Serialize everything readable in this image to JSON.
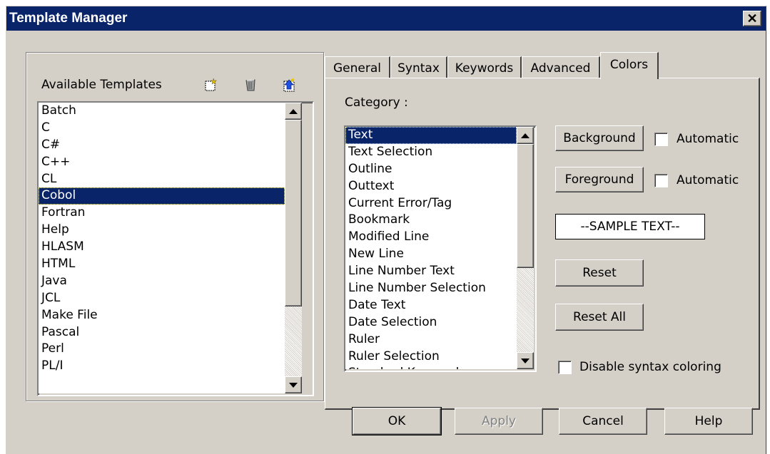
{
  "window": {
    "title": "Template Manager",
    "close_glyph": "✕"
  },
  "templates": {
    "header": "Available Templates",
    "toolbar_icons": [
      "new-template-icon",
      "delete-template-icon",
      "import-template-icon"
    ],
    "items": [
      "Batch",
      "C",
      "C#",
      "C++",
      "CL",
      "Cobol",
      "Fortran",
      "Help",
      "HLASM",
      "HTML",
      "Java",
      "JCL",
      "Make File",
      "Pascal",
      "Perl",
      "PL/I"
    ],
    "selected": "Cobol"
  },
  "tabs": [
    {
      "label": "General"
    },
    {
      "label": "Syntax"
    },
    {
      "label": "Keywords"
    },
    {
      "label": "Advanced"
    },
    {
      "label": "Colors",
      "active": true
    }
  ],
  "colors": {
    "category_label": "Category :",
    "categories": [
      "Text",
      "Text Selection",
      "Outline",
      "Outtext",
      "Current Error/Tag",
      "Bookmark",
      "Modified Line",
      "New Line",
      "Line Number Text",
      "Line Number Selection",
      "Date Text",
      "Date Selection",
      "Ruler",
      "Ruler Selection",
      "Standard Keywords"
    ],
    "selected_category": "Text",
    "background_button": "Background",
    "foreground_button": "Foreground",
    "automatic_label_1": "Automatic",
    "automatic_label_2": "Automatic",
    "automatic_bg_checked": false,
    "automatic_fg_checked": false,
    "sample_text": "--SAMPLE TEXT--",
    "reset_button": "Reset",
    "reset_all_button": "Reset All",
    "disable_syntax_label": "Disable syntax coloring",
    "disable_syntax_checked": false
  },
  "footer": {
    "ok": "OK",
    "apply": "Apply",
    "cancel": "Cancel",
    "help": "Help"
  },
  "theme": {
    "titlebar": "#0a246a",
    "face": "#d4d0c8",
    "selection": "#0a246a"
  }
}
